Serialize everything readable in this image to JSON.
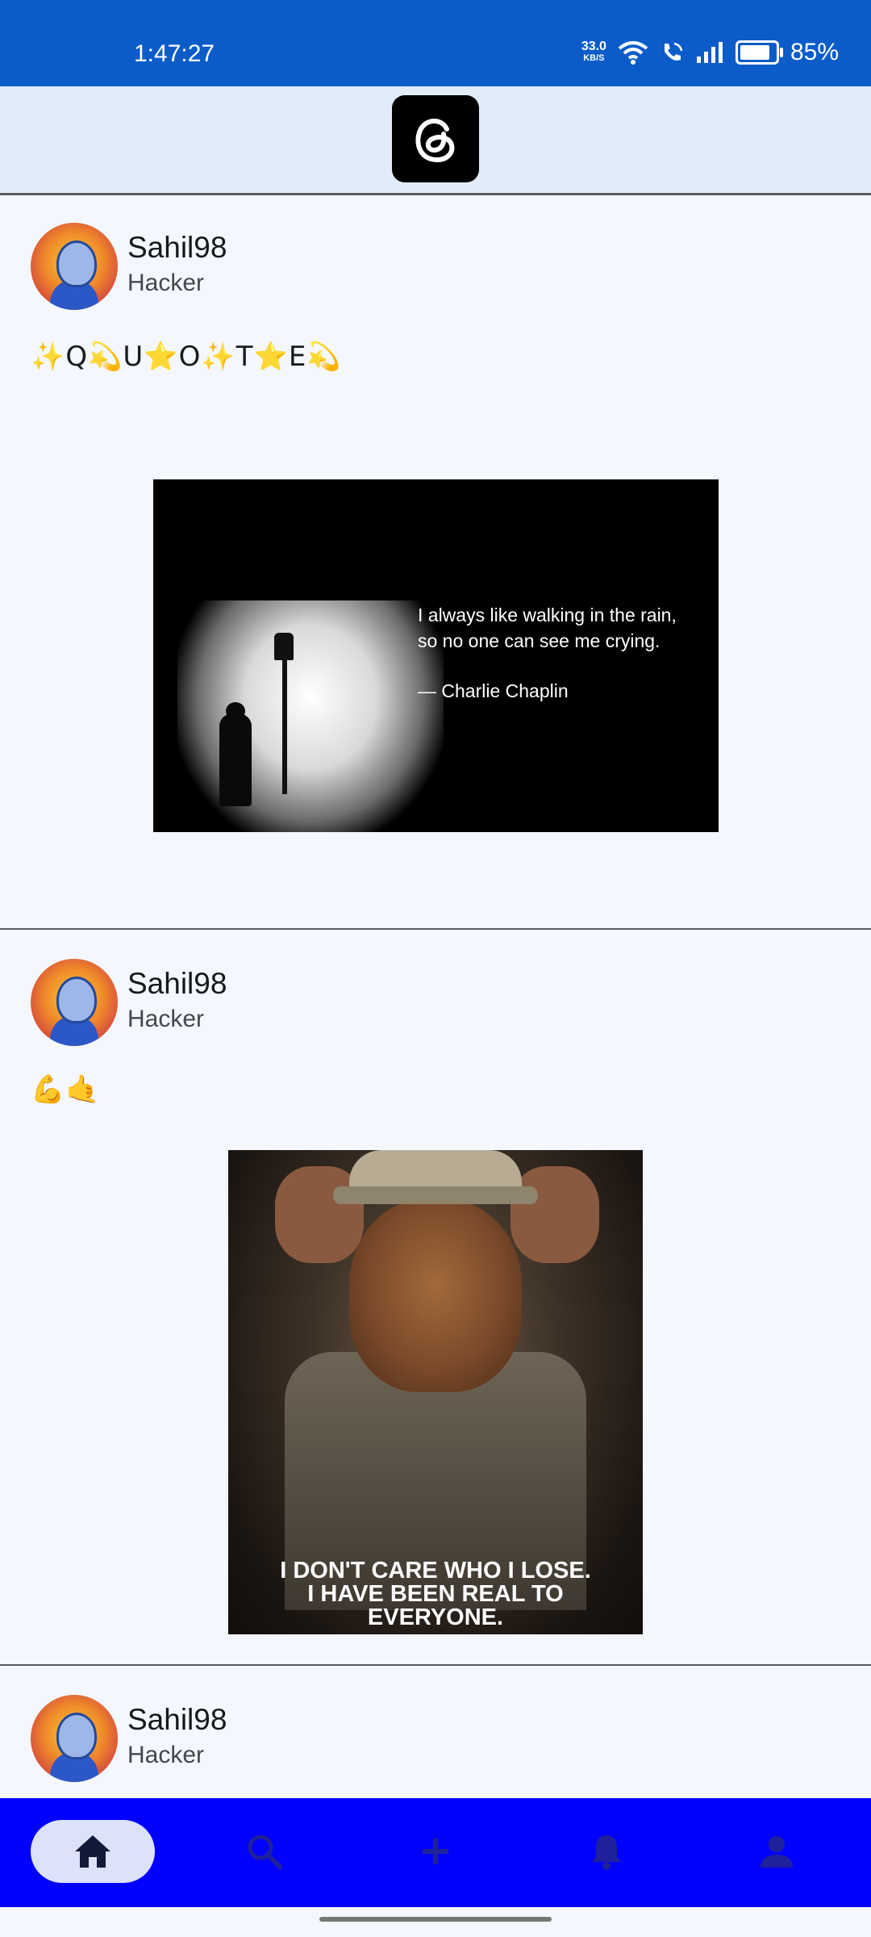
{
  "status_bar": {
    "time": "1:47:27",
    "net_speed_value": "33.0",
    "net_speed_unit": "KB/S",
    "battery_percent": "85%",
    "battery_level": 0.85
  },
  "app_bar": {
    "logo_icon": "threads-logo-icon"
  },
  "posts": [
    {
      "username": "Sahil98",
      "subtitle": "Hacker",
      "text": "✨Q💫U⭐O✨T⭐E💫",
      "image": {
        "quote_line1": "I always like walking in the rain,",
        "quote_line2": "so no one can see me crying.",
        "author": "— Charlie Chaplin"
      }
    },
    {
      "username": "Sahil98",
      "subtitle": "Hacker",
      "text": "💪🤙",
      "image": {
        "quote_line1": "I DON'T CARE WHO I LOSE.",
        "quote_line2": "I HAVE BEEN REAL TO",
        "quote_line3": "EVERYONE."
      }
    },
    {
      "username": "Sahil98",
      "subtitle": "Hacker"
    }
  ],
  "bottom_nav": {
    "items": [
      {
        "icon": "home-icon",
        "active": true
      },
      {
        "icon": "search-icon",
        "active": false
      },
      {
        "icon": "add-icon",
        "active": false
      },
      {
        "icon": "bell-icon",
        "active": false
      },
      {
        "icon": "profile-icon",
        "active": false
      }
    ],
    "colors": {
      "background": "#0000ff",
      "active_pill": "#dde2fb",
      "active_icon": "#121a3a",
      "inactive_icon": "#20209a"
    }
  },
  "colors": {
    "status_bar": "#0b5cc9",
    "app_bar": "#e2ecf9",
    "page": "#f4f7fd"
  }
}
